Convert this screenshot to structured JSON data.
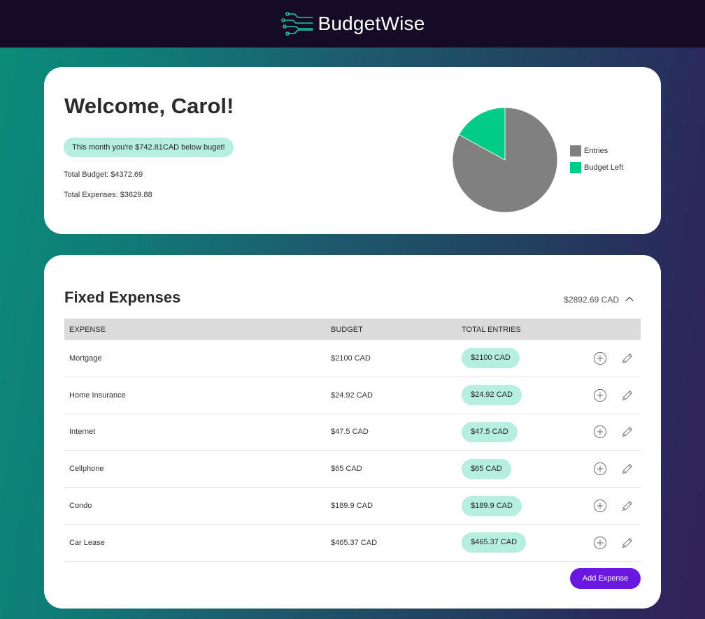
{
  "app": {
    "name": "BudgetWise",
    "logo_icon": "circuit-logo-icon"
  },
  "summary": {
    "welcome": "Welcome, Carol!",
    "status_message": "This month you're $742.81CAD below buget!",
    "total_budget": "Total Budget: $4372.69",
    "total_expenses": "Total Expenses: $3629.88"
  },
  "chart_data": {
    "type": "pie",
    "labels": [
      "Entries",
      "Budget Left"
    ],
    "values": [
      3629.88,
      742.81
    ],
    "colors": [
      "#808080",
      "#00cc88"
    ],
    "legend_position": "right"
  },
  "fixed_expenses": {
    "title": "Fixed Expenses",
    "total": "$2892.69 CAD",
    "collapse_icon": "chevron-up-icon",
    "columns": [
      "EXPENSE",
      "BUDGET",
      "TOTAL ENTRIES"
    ],
    "rows": [
      {
        "name": "Mortgage",
        "budget": "$2100 CAD",
        "entries": "$2100 CAD"
      },
      {
        "name": "Home Insurance",
        "budget": "$24.92 CAD",
        "entries": "$24.92 CAD"
      },
      {
        "name": "Internet",
        "budget": "$47.5 CAD",
        "entries": "$47.5 CAD"
      },
      {
        "name": "Cellphone",
        "budget": "$65 CAD",
        "entries": "$65 CAD"
      },
      {
        "name": "Condo",
        "budget": "$189.9 CAD",
        "entries": "$189.9 CAD"
      },
      {
        "name": "Car Lease",
        "budget": "$465.37 CAD",
        "entries": "$465.37 CAD"
      }
    ],
    "row_actions": [
      "plus-circle-icon",
      "pencil-icon"
    ],
    "add_button": "Add Expense"
  },
  "colors": {
    "accent": "#6a18e0",
    "pill": "#b6eee0",
    "topbar": "#150b26",
    "entries_slice": "#808080",
    "budget_left_slice": "#00cc88"
  }
}
